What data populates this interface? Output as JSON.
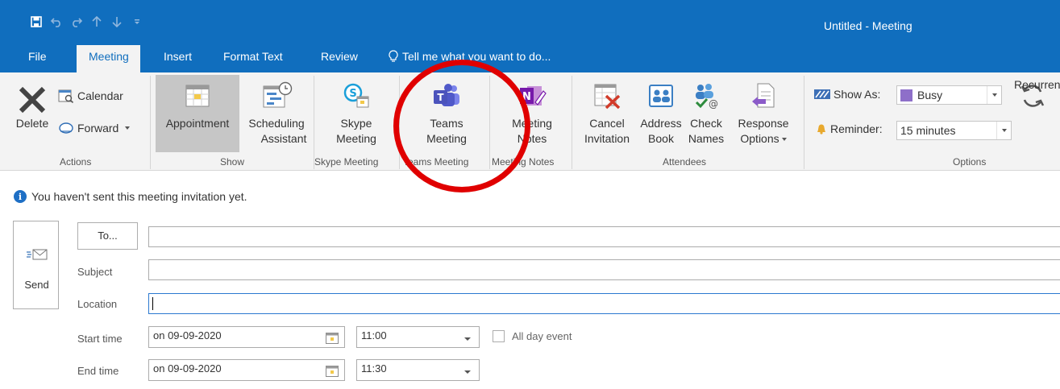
{
  "window": {
    "title": "Untitled - Meeting"
  },
  "qat": {
    "icons": [
      "save-icon",
      "undo-icon",
      "redo-icon",
      "up-icon",
      "down-icon",
      "customize-icon"
    ]
  },
  "tabs": [
    {
      "label": "File"
    },
    {
      "label": "Meeting",
      "active": true
    },
    {
      "label": "Insert"
    },
    {
      "label": "Format Text"
    },
    {
      "label": "Review"
    }
  ],
  "tell_me": "Tell me what you want to do...",
  "ribbon": {
    "actions": {
      "label": "Actions",
      "delete": "Delete",
      "calendar": "Calendar",
      "forward": "Forward"
    },
    "show": {
      "label": "Show",
      "appointment": "Appointment",
      "scheduling_1": "Scheduling",
      "scheduling_2": "Assistant"
    },
    "skype": {
      "label": "Skype Meeting",
      "btn_1": "Skype",
      "btn_2": "Meeting"
    },
    "teams": {
      "label": "Teams Meeting",
      "btn_1": "Teams",
      "btn_2": "Meeting"
    },
    "notes": {
      "label": "Meeting Notes",
      "btn_1": "Meeting",
      "btn_2": "Notes"
    },
    "attendees": {
      "label": "Attendees",
      "cancel_1": "Cancel",
      "cancel_2": "Invitation",
      "address_1": "Address",
      "address_2": "Book",
      "check_1": "Check",
      "check_2": "Names",
      "response_1": "Response",
      "response_2": "Options"
    },
    "options": {
      "label": "Options",
      "show_as_label": "Show As:",
      "show_as_value": "Busy",
      "busy_color": "#8e6fc9",
      "reminder_label": "Reminder:",
      "reminder_value": "15 minutes",
      "recurrence": "Recurrence"
    }
  },
  "info_message": "You haven't sent this meeting invitation yet.",
  "form": {
    "send": "Send",
    "to": "To...",
    "subject_label": "Subject",
    "location_label": "Location",
    "start_label": "Start time",
    "end_label": "End time",
    "start_date": "on 09-09-2020",
    "start_time": "11:00",
    "end_date": "on 09-09-2020",
    "end_time": "11:30",
    "all_day": "All day event"
  },
  "colors": {
    "accent": "#106ebe",
    "highlight_circle": "#e00000"
  }
}
